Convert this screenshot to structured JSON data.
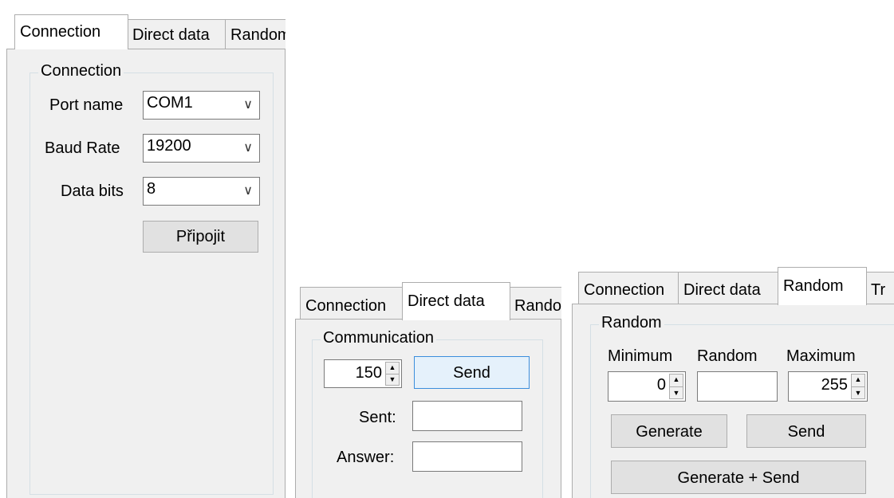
{
  "panel1": {
    "tabs": [
      "Connection",
      "Direct data",
      "Random"
    ],
    "group_title": "Connection",
    "port_label": "Port name",
    "port_value": "COM1",
    "baud_label": "Baud Rate",
    "baud_value": "19200",
    "databits_label": "Data bits",
    "databits_value": "8",
    "connect_button": "Připojit"
  },
  "panel2": {
    "tabs": [
      "Connection",
      "Direct data",
      "Random"
    ],
    "group_title": "Communication",
    "value": "150",
    "send_button": "Send",
    "sent_label": "Sent:",
    "answer_label": "Answer:"
  },
  "panel3": {
    "tabs": [
      "Connection",
      "Direct data",
      "Random",
      "Tr"
    ],
    "group_title": "Random",
    "min_label": "Minimum",
    "rand_label": "Random",
    "max_label": "Maximum",
    "min_value": "0",
    "max_value": "255",
    "generate_button": "Generate",
    "send_button": "Send",
    "gensend_button": "Generate + Send"
  }
}
